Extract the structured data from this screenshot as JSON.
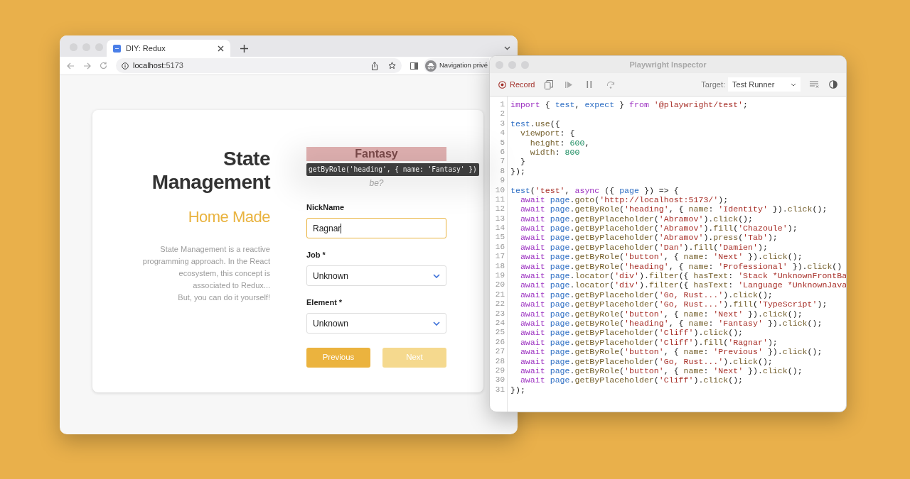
{
  "browser": {
    "tab": {
      "title": "DIY: Redux",
      "selected": true
    },
    "url": {
      "host": "localhost",
      "port": ":5173"
    },
    "profile": "Navigation privé",
    "page": {
      "title_lines": [
        "State",
        "Management"
      ],
      "subtitle": "Home Made",
      "description": "State Management is a reactive programming approach. In the React ecosystem, this concept is associated to Redux...\nBut, you can do it yourself!",
      "step_heading": "Fantasy",
      "step_subtitle": "be?",
      "highlight_tooltip": "getByRole('heading', { name: 'Fantasy' })",
      "fields": [
        {
          "kind": "input",
          "label": "NickName",
          "value": "Ragnar",
          "focused": true
        },
        {
          "kind": "select",
          "label": "Job",
          "required": "*",
          "value": "Unknown",
          "focused": false
        },
        {
          "kind": "select",
          "label": "Element",
          "required": "*",
          "value": "Unknown",
          "focused": false
        }
      ],
      "buttons": [
        {
          "label": "Previous",
          "disabled": false
        },
        {
          "label": "Next",
          "disabled": true
        }
      ]
    }
  },
  "inspector": {
    "title": "Playwright Inspector",
    "record": "Record",
    "target_label": "Target:",
    "target": "Test Runner",
    "code": [
      {
        "number": "1",
        "tokens": [
          {
            "kind": "keyword",
            "text": "import"
          },
          {
            "kind": "plain",
            "text": " { "
          },
          {
            "kind": "variable",
            "text": "test"
          },
          {
            "kind": "plain",
            "text": ", "
          },
          {
            "kind": "variable",
            "text": "expect"
          },
          {
            "kind": "plain",
            "text": " } "
          },
          {
            "kind": "keyword",
            "text": "from "
          },
          {
            "kind": "string",
            "text": "'@playwright/test'"
          },
          {
            "kind": "plain",
            "text": ";"
          }
        ]
      },
      {
        "number": "2"
      },
      {
        "number": "3",
        "tokens": [
          {
            "kind": "variable",
            "text": "test"
          },
          {
            "kind": "plain",
            "text": "."
          },
          {
            "kind": "method",
            "text": "use"
          },
          {
            "kind": "plain",
            "text": "({"
          }
        ]
      },
      {
        "number": "4",
        "tokens": [
          {
            "kind": "method",
            "text": "  viewport"
          },
          {
            "kind": "plain",
            "text": ": {"
          }
        ]
      },
      {
        "number": "5",
        "tokens": [
          {
            "kind": "method",
            "text": "    height"
          },
          {
            "kind": "plain",
            "text": ": "
          },
          {
            "kind": "number",
            "text": "600"
          },
          {
            "kind": "plain",
            "text": ","
          }
        ]
      },
      {
        "number": "6",
        "tokens": [
          {
            "kind": "method",
            "text": "    width"
          },
          {
            "kind": "plain",
            "text": ": "
          },
          {
            "kind": "number",
            "text": "800"
          }
        ]
      },
      {
        "number": "7",
        "tokens": [
          {
            "kind": "plain",
            "text": "  }"
          }
        ]
      },
      {
        "number": "8",
        "tokens": [
          {
            "kind": "plain",
            "text": "});"
          }
        ]
      },
      {
        "number": "9"
      },
      {
        "number": "10",
        "tokens": [
          {
            "kind": "variable",
            "text": "test"
          },
          {
            "kind": "plain",
            "text": "("
          },
          {
            "kind": "string",
            "text": "'test'"
          },
          {
            "kind": "plain",
            "text": ", "
          },
          {
            "kind": "keyword",
            "text": "async"
          },
          {
            "kind": "plain",
            "text": " ({ "
          },
          {
            "kind": "variable",
            "text": "page"
          },
          {
            "kind": "plain",
            "text": " }) => {"
          }
        ]
      },
      {
        "number": "11",
        "tokens": [
          {
            "kind": "keyword",
            "text": "  await "
          },
          {
            "kind": "variable",
            "text": "page"
          },
          {
            "kind": "plain",
            "text": "."
          },
          {
            "kind": "method",
            "text": "goto"
          },
          {
            "kind": "plain",
            "text": "("
          },
          {
            "kind": "string",
            "text": "'http://localhost:5173/'"
          },
          {
            "kind": "plain",
            "text": ");"
          }
        ]
      },
      {
        "number": "12",
        "tokens": [
          {
            "kind": "keyword",
            "text": "  await "
          },
          {
            "kind": "variable",
            "text": "page"
          },
          {
            "kind": "plain",
            "text": "."
          },
          {
            "kind": "method",
            "text": "getByRole"
          },
          {
            "kind": "plain",
            "text": "("
          },
          {
            "kind": "string",
            "text": "'heading'"
          },
          {
            "kind": "plain",
            "text": ", { "
          },
          {
            "kind": "method",
            "text": "name"
          },
          {
            "kind": "plain",
            "text": ": "
          },
          {
            "kind": "string",
            "text": "'Identity'"
          },
          {
            "kind": "plain",
            "text": " })."
          },
          {
            "kind": "method",
            "text": "click"
          },
          {
            "kind": "plain",
            "text": "();"
          }
        ]
      },
      {
        "number": "13",
        "tokens": [
          {
            "kind": "keyword",
            "text": "  await "
          },
          {
            "kind": "variable",
            "text": "page"
          },
          {
            "kind": "plain",
            "text": "."
          },
          {
            "kind": "method",
            "text": "getByPlaceholder"
          },
          {
            "kind": "plain",
            "text": "("
          },
          {
            "kind": "string",
            "text": "'Abramov'"
          },
          {
            "kind": "plain",
            "text": ")."
          },
          {
            "kind": "method",
            "text": "click"
          },
          {
            "kind": "plain",
            "text": "();"
          }
        ]
      },
      {
        "number": "14",
        "tokens": [
          {
            "kind": "keyword",
            "text": "  await "
          },
          {
            "kind": "variable",
            "text": "page"
          },
          {
            "kind": "plain",
            "text": "."
          },
          {
            "kind": "method",
            "text": "getByPlaceholder"
          },
          {
            "kind": "plain",
            "text": "("
          },
          {
            "kind": "string",
            "text": "'Abramov'"
          },
          {
            "kind": "plain",
            "text": ")."
          },
          {
            "kind": "method",
            "text": "fill"
          },
          {
            "kind": "plain",
            "text": "("
          },
          {
            "kind": "string",
            "text": "'Chazoule'"
          },
          {
            "kind": "plain",
            "text": ");"
          }
        ]
      },
      {
        "number": "15",
        "tokens": [
          {
            "kind": "keyword",
            "text": "  await "
          },
          {
            "kind": "variable",
            "text": "page"
          },
          {
            "kind": "plain",
            "text": "."
          },
          {
            "kind": "method",
            "text": "getByPlaceholder"
          },
          {
            "kind": "plain",
            "text": "("
          },
          {
            "kind": "string",
            "text": "'Abramov'"
          },
          {
            "kind": "plain",
            "text": ")."
          },
          {
            "kind": "method",
            "text": "press"
          },
          {
            "kind": "plain",
            "text": "("
          },
          {
            "kind": "string",
            "text": "'Tab'"
          },
          {
            "kind": "plain",
            "text": ");"
          }
        ]
      },
      {
        "number": "16",
        "tokens": [
          {
            "kind": "keyword",
            "text": "  await "
          },
          {
            "kind": "variable",
            "text": "page"
          },
          {
            "kind": "plain",
            "text": "."
          },
          {
            "kind": "method",
            "text": "getByPlaceholder"
          },
          {
            "kind": "plain",
            "text": "("
          },
          {
            "kind": "string",
            "text": "'Dan'"
          },
          {
            "kind": "plain",
            "text": ")."
          },
          {
            "kind": "method",
            "text": "fill"
          },
          {
            "kind": "plain",
            "text": "("
          },
          {
            "kind": "string",
            "text": "'Damien'"
          },
          {
            "kind": "plain",
            "text": ");"
          }
        ]
      },
      {
        "number": "17",
        "tokens": [
          {
            "kind": "keyword",
            "text": "  await "
          },
          {
            "kind": "variable",
            "text": "page"
          },
          {
            "kind": "plain",
            "text": "."
          },
          {
            "kind": "method",
            "text": "getByRole"
          },
          {
            "kind": "plain",
            "text": "("
          },
          {
            "kind": "string",
            "text": "'button'"
          },
          {
            "kind": "plain",
            "text": ", { "
          },
          {
            "kind": "method",
            "text": "name"
          },
          {
            "kind": "plain",
            "text": ": "
          },
          {
            "kind": "string",
            "text": "'Next'"
          },
          {
            "kind": "plain",
            "text": " })."
          },
          {
            "kind": "method",
            "text": "click"
          },
          {
            "kind": "plain",
            "text": "();"
          }
        ]
      },
      {
        "number": "18",
        "tokens": [
          {
            "kind": "keyword",
            "text": "  await "
          },
          {
            "kind": "variable",
            "text": "page"
          },
          {
            "kind": "plain",
            "text": "."
          },
          {
            "kind": "method",
            "text": "getByRole"
          },
          {
            "kind": "plain",
            "text": "("
          },
          {
            "kind": "string",
            "text": "'heading'"
          },
          {
            "kind": "plain",
            "text": ", { "
          },
          {
            "kind": "method",
            "text": "name"
          },
          {
            "kind": "plain",
            "text": ": "
          },
          {
            "kind": "string",
            "text": "'Professional'"
          },
          {
            "kind": "plain",
            "text": " })."
          },
          {
            "kind": "method",
            "text": "click"
          },
          {
            "kind": "plain",
            "text": "()"
          }
        ]
      },
      {
        "number": "19",
        "tokens": [
          {
            "kind": "keyword",
            "text": "  await "
          },
          {
            "kind": "variable",
            "text": "page"
          },
          {
            "kind": "plain",
            "text": "."
          },
          {
            "kind": "method",
            "text": "locator"
          },
          {
            "kind": "plain",
            "text": "("
          },
          {
            "kind": "string",
            "text": "'div'"
          },
          {
            "kind": "plain",
            "text": ")."
          },
          {
            "kind": "method",
            "text": "filter"
          },
          {
            "kind": "plain",
            "text": "({ "
          },
          {
            "kind": "method",
            "text": "hasText"
          },
          {
            "kind": "plain",
            "text": ": "
          },
          {
            "kind": "string",
            "text": "'Stack *UnknownFrontBa"
          }
        ]
      },
      {
        "number": "20",
        "tokens": [
          {
            "kind": "keyword",
            "text": "  await "
          },
          {
            "kind": "variable",
            "text": "page"
          },
          {
            "kind": "plain",
            "text": "."
          },
          {
            "kind": "method",
            "text": "locator"
          },
          {
            "kind": "plain",
            "text": "("
          },
          {
            "kind": "string",
            "text": "'div'"
          },
          {
            "kind": "plain",
            "text": ")."
          },
          {
            "kind": "method",
            "text": "filter"
          },
          {
            "kind": "plain",
            "text": "({ "
          },
          {
            "kind": "method",
            "text": "hasText"
          },
          {
            "kind": "plain",
            "text": ": "
          },
          {
            "kind": "string",
            "text": "'Language *UnknownJava"
          }
        ]
      },
      {
        "number": "21",
        "tokens": [
          {
            "kind": "keyword",
            "text": "  await "
          },
          {
            "kind": "variable",
            "text": "page"
          },
          {
            "kind": "plain",
            "text": "."
          },
          {
            "kind": "method",
            "text": "getByPlaceholder"
          },
          {
            "kind": "plain",
            "text": "("
          },
          {
            "kind": "string",
            "text": "'Go, Rust...'"
          },
          {
            "kind": "plain",
            "text": ")."
          },
          {
            "kind": "method",
            "text": "click"
          },
          {
            "kind": "plain",
            "text": "();"
          }
        ]
      },
      {
        "number": "22",
        "tokens": [
          {
            "kind": "keyword",
            "text": "  await "
          },
          {
            "kind": "variable",
            "text": "page"
          },
          {
            "kind": "plain",
            "text": "."
          },
          {
            "kind": "method",
            "text": "getByPlaceholder"
          },
          {
            "kind": "plain",
            "text": "("
          },
          {
            "kind": "string",
            "text": "'Go, Rust...'"
          },
          {
            "kind": "plain",
            "text": ")."
          },
          {
            "kind": "method",
            "text": "fill"
          },
          {
            "kind": "plain",
            "text": "("
          },
          {
            "kind": "string",
            "text": "'TypeScript'"
          },
          {
            "kind": "plain",
            "text": ");"
          }
        ]
      },
      {
        "number": "23",
        "tokens": [
          {
            "kind": "keyword",
            "text": "  await "
          },
          {
            "kind": "variable",
            "text": "page"
          },
          {
            "kind": "plain",
            "text": "."
          },
          {
            "kind": "method",
            "text": "getByRole"
          },
          {
            "kind": "plain",
            "text": "("
          },
          {
            "kind": "string",
            "text": "'button'"
          },
          {
            "kind": "plain",
            "text": ", { "
          },
          {
            "kind": "method",
            "text": "name"
          },
          {
            "kind": "plain",
            "text": ": "
          },
          {
            "kind": "string",
            "text": "'Next'"
          },
          {
            "kind": "plain",
            "text": " })."
          },
          {
            "kind": "method",
            "text": "click"
          },
          {
            "kind": "plain",
            "text": "();"
          }
        ]
      },
      {
        "number": "24",
        "tokens": [
          {
            "kind": "keyword",
            "text": "  await "
          },
          {
            "kind": "variable",
            "text": "page"
          },
          {
            "kind": "plain",
            "text": "."
          },
          {
            "kind": "method",
            "text": "getByRole"
          },
          {
            "kind": "plain",
            "text": "("
          },
          {
            "kind": "string",
            "text": "'heading'"
          },
          {
            "kind": "plain",
            "text": ", { "
          },
          {
            "kind": "method",
            "text": "name"
          },
          {
            "kind": "plain",
            "text": ": "
          },
          {
            "kind": "string",
            "text": "'Fantasy'"
          },
          {
            "kind": "plain",
            "text": " })."
          },
          {
            "kind": "method",
            "text": "click"
          },
          {
            "kind": "plain",
            "text": "();"
          }
        ]
      },
      {
        "number": "25",
        "tokens": [
          {
            "kind": "keyword",
            "text": "  await "
          },
          {
            "kind": "variable",
            "text": "page"
          },
          {
            "kind": "plain",
            "text": "."
          },
          {
            "kind": "method",
            "text": "getByPlaceholder"
          },
          {
            "kind": "plain",
            "text": "("
          },
          {
            "kind": "string",
            "text": "'Cliff'"
          },
          {
            "kind": "plain",
            "text": ")."
          },
          {
            "kind": "method",
            "text": "click"
          },
          {
            "kind": "plain",
            "text": "();"
          }
        ]
      },
      {
        "number": "26",
        "tokens": [
          {
            "kind": "keyword",
            "text": "  await "
          },
          {
            "kind": "variable",
            "text": "page"
          },
          {
            "kind": "plain",
            "text": "."
          },
          {
            "kind": "method",
            "text": "getByPlaceholder"
          },
          {
            "kind": "plain",
            "text": "("
          },
          {
            "kind": "string",
            "text": "'Cliff'"
          },
          {
            "kind": "plain",
            "text": ")."
          },
          {
            "kind": "method",
            "text": "fill"
          },
          {
            "kind": "plain",
            "text": "("
          },
          {
            "kind": "string",
            "text": "'Ragnar'"
          },
          {
            "kind": "plain",
            "text": ");"
          }
        ]
      },
      {
        "number": "27",
        "tokens": [
          {
            "kind": "keyword",
            "text": "  await "
          },
          {
            "kind": "variable",
            "text": "page"
          },
          {
            "kind": "plain",
            "text": "."
          },
          {
            "kind": "method",
            "text": "getByRole"
          },
          {
            "kind": "plain",
            "text": "("
          },
          {
            "kind": "string",
            "text": "'button'"
          },
          {
            "kind": "plain",
            "text": ", { "
          },
          {
            "kind": "method",
            "text": "name"
          },
          {
            "kind": "plain",
            "text": ": "
          },
          {
            "kind": "string",
            "text": "'Previous'"
          },
          {
            "kind": "plain",
            "text": " })."
          },
          {
            "kind": "method",
            "text": "click"
          },
          {
            "kind": "plain",
            "text": "();"
          }
        ]
      },
      {
        "number": "28",
        "tokens": [
          {
            "kind": "keyword",
            "text": "  await "
          },
          {
            "kind": "variable",
            "text": "page"
          },
          {
            "kind": "plain",
            "text": "."
          },
          {
            "kind": "method",
            "text": "getByPlaceholder"
          },
          {
            "kind": "plain",
            "text": "("
          },
          {
            "kind": "string",
            "text": "'Go, Rust...'"
          },
          {
            "kind": "plain",
            "text": ")."
          },
          {
            "kind": "method",
            "text": "click"
          },
          {
            "kind": "plain",
            "text": "();"
          }
        ]
      },
      {
        "number": "29",
        "tokens": [
          {
            "kind": "keyword",
            "text": "  await "
          },
          {
            "kind": "variable",
            "text": "page"
          },
          {
            "kind": "plain",
            "text": "."
          },
          {
            "kind": "method",
            "text": "getByRole"
          },
          {
            "kind": "plain",
            "text": "("
          },
          {
            "kind": "string",
            "text": "'button'"
          },
          {
            "kind": "plain",
            "text": ", { "
          },
          {
            "kind": "method",
            "text": "name"
          },
          {
            "kind": "plain",
            "text": ": "
          },
          {
            "kind": "string",
            "text": "'Next'"
          },
          {
            "kind": "plain",
            "text": " })."
          },
          {
            "kind": "method",
            "text": "click"
          },
          {
            "kind": "plain",
            "text": "();"
          }
        ]
      },
      {
        "number": "30",
        "tokens": [
          {
            "kind": "keyword",
            "text": "  await "
          },
          {
            "kind": "variable",
            "text": "page"
          },
          {
            "kind": "plain",
            "text": "."
          },
          {
            "kind": "method",
            "text": "getByPlaceholder"
          },
          {
            "kind": "plain",
            "text": "("
          },
          {
            "kind": "string",
            "text": "'Cliff'"
          },
          {
            "kind": "plain",
            "text": ")."
          },
          {
            "kind": "method",
            "text": "click"
          },
          {
            "kind": "plain",
            "text": "();"
          }
        ]
      },
      {
        "number": "31",
        "tokens": [
          {
            "kind": "plain",
            "text": "});"
          }
        ]
      }
    ]
  }
}
